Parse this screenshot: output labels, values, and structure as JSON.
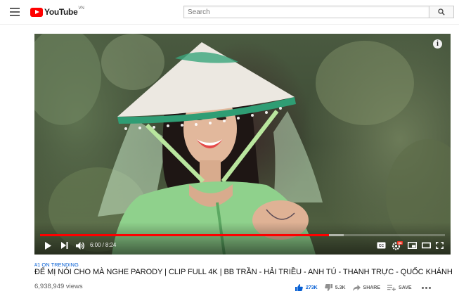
{
  "header": {
    "logo_text": "YouTube",
    "logo_region": "VN",
    "search_placeholder": "Search",
    "icons": [
      "menu-icon",
      "youtube-logo-icon",
      "search-icon"
    ]
  },
  "player": {
    "current_time": "6:00",
    "separator": "/",
    "duration": "8:24",
    "progress": 0.714,
    "buffered": 0.75,
    "accent_color": "#ff0000",
    "icons": [
      "info-icon",
      "play-icon",
      "next-icon",
      "volume-icon",
      "captions-icon",
      "settings-icon",
      "miniplayer-icon",
      "theater-icon",
      "fullscreen-icon"
    ],
    "settings_badge": "HD"
  },
  "video": {
    "trending": "#1 ON TRENDING",
    "title": "ĐỂ MỊ NÓI CHO MÀ NGHE PARODY | CLIP FULL 4K | BB TRẦN - HẢI TRIỀU - ANH TÚ - THANH TRỰC - QUỐC KHÁNH",
    "views": "6,938,949 views",
    "likes": "273K",
    "dislikes": "5.3K",
    "share_label": "SHARE",
    "save_label": "SAVE"
  }
}
